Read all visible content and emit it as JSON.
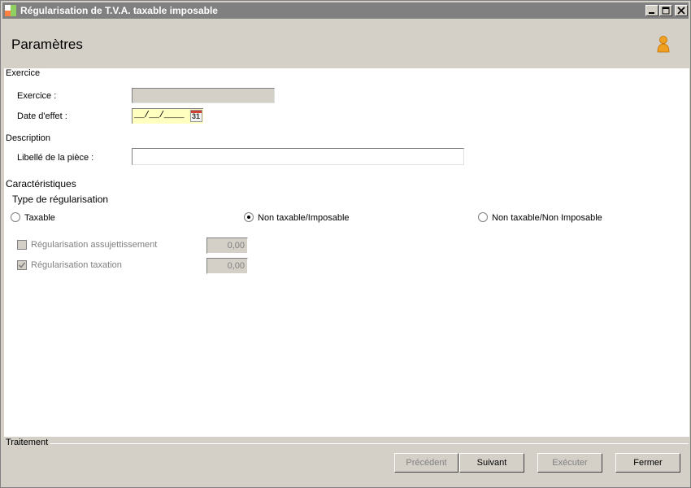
{
  "window": {
    "title": "Régularisation de T.V.A. taxable imposable"
  },
  "header": {
    "title": "Paramètres"
  },
  "sections": {
    "exercice": {
      "heading": "Exercice",
      "exercice_label": "Exercice :",
      "exercice_value": "",
      "date_label": "Date d'effet :",
      "date_value": "__/__/____",
      "calendar_day": "31"
    },
    "description": {
      "heading": "Description",
      "libelle_label": "Libellé de la pièce :",
      "libelle_value": ""
    },
    "caracteristiques": {
      "heading": "Caractéristiques",
      "type_heading": "Type de régularisation",
      "radios": [
        {
          "label": "Taxable",
          "checked": false
        },
        {
          "label": "Non taxable/Imposable",
          "checked": true
        },
        {
          "label": "Non taxable/Non Imposable",
          "checked": false
        }
      ],
      "checks": [
        {
          "label": "Régularisation assujettissement",
          "checked": false,
          "value": "0,00"
        },
        {
          "label": "Régularisation taxation",
          "checked": true,
          "value": "0,00"
        }
      ]
    }
  },
  "footer": {
    "heading": "Traitement",
    "buttons": {
      "precedent": "Précédent",
      "suivant": "Suivant",
      "executer": "Exécuter",
      "fermer": "Fermer"
    }
  },
  "icons": {
    "app": "app-icon",
    "minimize": "minimize-icon",
    "maximize": "maximize-icon",
    "close": "close-icon",
    "user": "user-icon",
    "calendar": "calendar-icon"
  }
}
